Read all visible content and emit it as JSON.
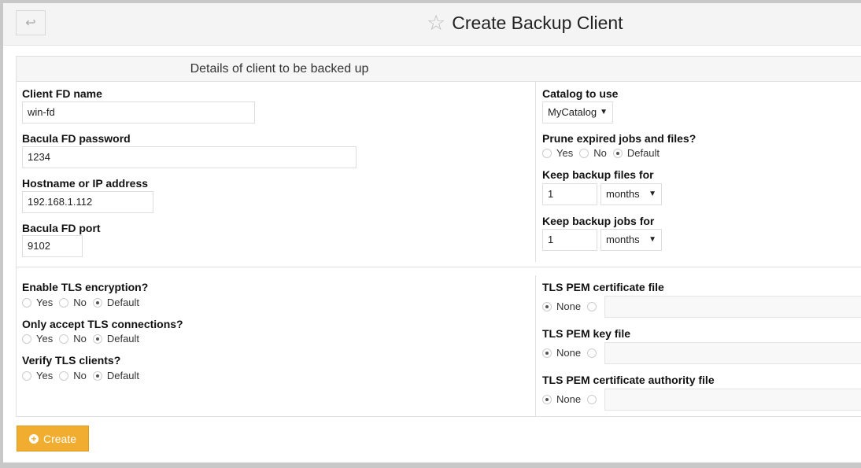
{
  "header": {
    "back_icon": "return-arrow",
    "title": "Create Backup Client",
    "star_icon": "star-outline"
  },
  "panel": {
    "title": "Details of client to be backed up"
  },
  "client": {
    "name_label": "Client FD name",
    "name_value": "win-fd",
    "password_label": "Bacula FD password",
    "password_value": "1234",
    "host_label": "Hostname or IP address",
    "host_value": "192.168.1.112",
    "port_label": "Bacula FD port",
    "port_value": "9102"
  },
  "catalog": {
    "label": "Catalog to use",
    "value": "MyCatalog"
  },
  "prune": {
    "label": "Prune expired jobs and files?",
    "options": [
      "Yes",
      "No",
      "Default"
    ],
    "selected": "Default"
  },
  "keep_files": {
    "label": "Keep backup files for",
    "value": "1",
    "unit": "months"
  },
  "keep_jobs": {
    "label": "Keep backup jobs for",
    "value": "1",
    "unit": "months"
  },
  "tls": {
    "enable": {
      "label": "Enable TLS encryption?",
      "options": [
        "Yes",
        "No",
        "Default"
      ],
      "selected": "Default"
    },
    "require": {
      "label": "Only accept TLS connections?",
      "options": [
        "Yes",
        "No",
        "Default"
      ],
      "selected": "Default"
    },
    "verify": {
      "label": "Verify TLS clients?",
      "options": [
        "Yes",
        "No",
        "Default"
      ],
      "selected": "Default"
    },
    "cert": {
      "label": "TLS PEM certificate file",
      "none": "None"
    },
    "key": {
      "label": "TLS PEM key file",
      "none": "None"
    },
    "ca": {
      "label": "TLS PEM certificate authority file",
      "none": "None"
    }
  },
  "actions": {
    "create": "Create"
  },
  "colors": {
    "accent": "#f0ad30"
  }
}
